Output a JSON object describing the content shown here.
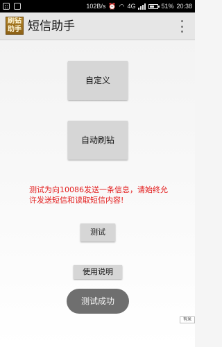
{
  "status_bar": {
    "network_speed": "102B/s",
    "network_type": "4G",
    "battery_percent": "51%",
    "time": "20:38"
  },
  "app_bar": {
    "logo_text": "刷钻助手",
    "title": "短信助手"
  },
  "main": {
    "custom_button_label": "自定义",
    "auto_button_label": "自动刷钻",
    "notice_text": "测试为向10086发送一条信息，请始终允许发送短信和读取短信内容!",
    "test_button_label": "测试",
    "help_button_label": "使用说明"
  },
  "toast": {
    "text": "测试成功"
  },
  "corner_badge": {
    "text": "有米"
  }
}
